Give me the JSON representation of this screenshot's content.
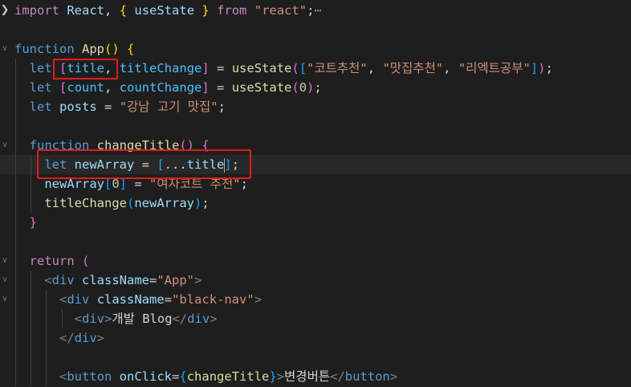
{
  "editor": {
    "lines": [
      {
        "tokens": [
          [
            "ctl",
            "import"
          ],
          [
            "pun",
            " "
          ],
          [
            "vr",
            "React"
          ],
          [
            "pun",
            ", "
          ],
          [
            "br1",
            "{"
          ],
          [
            "pun",
            " "
          ],
          [
            "vr",
            "useState"
          ],
          [
            "pun",
            " "
          ],
          [
            "br1",
            "}"
          ],
          [
            "pun",
            " "
          ],
          [
            "ctl",
            "from"
          ],
          [
            "pun",
            " "
          ],
          [
            "str",
            "\"react\""
          ],
          [
            "pun",
            ";"
          ],
          [
            "ell",
            "⋯"
          ]
        ]
      },
      {
        "tokens": []
      },
      {
        "tokens": [
          [
            "kw",
            "function"
          ],
          [
            "pun",
            " "
          ],
          [
            "fn",
            "App"
          ],
          [
            "br1",
            "()"
          ],
          [
            "pun",
            " "
          ],
          [
            "br1",
            "{"
          ]
        ]
      },
      {
        "tokens": [
          [
            "pun",
            "  "
          ],
          [
            "kw",
            "let"
          ],
          [
            "pun",
            " "
          ],
          [
            "br2",
            "["
          ],
          [
            "cn",
            "title"
          ],
          [
            "pun",
            ", "
          ],
          [
            "cn",
            "titleChange"
          ],
          [
            "br2",
            "]"
          ],
          [
            "pun",
            " = "
          ],
          [
            "fn",
            "useState"
          ],
          [
            "br2",
            "("
          ],
          [
            "br3",
            "["
          ],
          [
            "str",
            "\"코트추천\""
          ],
          [
            "pun",
            ", "
          ],
          [
            "str",
            "\"맛집추천\""
          ],
          [
            "pun",
            ", "
          ],
          [
            "str",
            "\"리엑트공부\""
          ],
          [
            "br3",
            "]"
          ],
          [
            "br2",
            ")"
          ],
          [
            "pun",
            ";"
          ]
        ]
      },
      {
        "tokens": [
          [
            "pun",
            "  "
          ],
          [
            "kw",
            "let"
          ],
          [
            "pun",
            " "
          ],
          [
            "br2",
            "["
          ],
          [
            "cn",
            "count"
          ],
          [
            "pun",
            ", "
          ],
          [
            "cn",
            "countChange"
          ],
          [
            "br2",
            "]"
          ],
          [
            "pun",
            " = "
          ],
          [
            "fn",
            "useState"
          ],
          [
            "br2",
            "("
          ],
          [
            "num",
            "0"
          ],
          [
            "br2",
            ")"
          ],
          [
            "pun",
            ";"
          ]
        ]
      },
      {
        "tokens": [
          [
            "pun",
            "  "
          ],
          [
            "kw",
            "let"
          ],
          [
            "pun",
            " "
          ],
          [
            "vr",
            "posts"
          ],
          [
            "pun",
            " = "
          ],
          [
            "str",
            "\"강남 고기 맛집\""
          ],
          [
            "pun",
            ";"
          ]
        ]
      },
      {
        "tokens": []
      },
      {
        "tokens": [
          [
            "pun",
            "  "
          ],
          [
            "kw",
            "function"
          ],
          [
            "pun",
            " "
          ],
          [
            "fn",
            "changeTitle"
          ],
          [
            "br2",
            "()"
          ],
          [
            "pun",
            " "
          ],
          [
            "br2",
            "{"
          ]
        ]
      },
      {
        "tokens": [
          [
            "pun",
            "    "
          ],
          [
            "kw",
            "let"
          ],
          [
            "pun",
            " "
          ],
          [
            "vr",
            "newArray"
          ],
          [
            "pun",
            " = "
          ],
          [
            "br3",
            "["
          ],
          [
            "pun",
            "..."
          ],
          [
            "vr",
            "title"
          ],
          [
            "caret",
            ""
          ],
          [
            "br3",
            "]"
          ],
          [
            "pun",
            ";"
          ]
        ]
      },
      {
        "tokens": [
          [
            "pun",
            "    "
          ],
          [
            "vr",
            "newArray"
          ],
          [
            "br3",
            "["
          ],
          [
            "num",
            "0"
          ],
          [
            "br3",
            "]"
          ],
          [
            "pun",
            " = "
          ],
          [
            "str",
            "\"여자코트 추천\""
          ],
          [
            "pun",
            ";"
          ]
        ]
      },
      {
        "tokens": [
          [
            "pun",
            "    "
          ],
          [
            "fn",
            "titleChange"
          ],
          [
            "br3",
            "("
          ],
          [
            "vr",
            "newArray"
          ],
          [
            "br3",
            ")"
          ],
          [
            "pun",
            ";"
          ]
        ]
      },
      {
        "tokens": [
          [
            "pun",
            "  "
          ],
          [
            "br2",
            "}"
          ]
        ]
      },
      {
        "tokens": []
      },
      {
        "tokens": [
          [
            "pun",
            "  "
          ],
          [
            "ctl",
            "return"
          ],
          [
            "pun",
            " "
          ],
          [
            "br2",
            "("
          ]
        ]
      },
      {
        "tokens": [
          [
            "pun",
            "    "
          ],
          [
            "angle",
            "<"
          ],
          [
            "tag",
            "div"
          ],
          [
            "pun",
            " "
          ],
          [
            "attr",
            "className"
          ],
          [
            "pun",
            "="
          ],
          [
            "str",
            "\"App\""
          ],
          [
            "angle",
            ">"
          ]
        ]
      },
      {
        "tokens": [
          [
            "pun",
            "      "
          ],
          [
            "angle",
            "<"
          ],
          [
            "tag",
            "div"
          ],
          [
            "pun",
            " "
          ],
          [
            "attr",
            "className"
          ],
          [
            "pun",
            "="
          ],
          [
            "str",
            "\"black-nav\""
          ],
          [
            "angle",
            ">"
          ]
        ]
      },
      {
        "tokens": [
          [
            "pun",
            "        "
          ],
          [
            "angle",
            "<"
          ],
          [
            "tag",
            "div"
          ],
          [
            "angle",
            ">"
          ],
          [
            "pun",
            "개발 Blog"
          ],
          [
            "angle",
            "</"
          ],
          [
            "tag",
            "div"
          ],
          [
            "angle",
            ">"
          ]
        ]
      },
      {
        "tokens": [
          [
            "pun",
            "      "
          ],
          [
            "angle",
            "</"
          ],
          [
            "tag",
            "div"
          ],
          [
            "angle",
            ">"
          ]
        ]
      },
      {
        "tokens": []
      },
      {
        "tokens": [
          [
            "pun",
            "      "
          ],
          [
            "angle",
            "<"
          ],
          [
            "tag",
            "button"
          ],
          [
            "pun",
            " "
          ],
          [
            "attr",
            "onClick"
          ],
          [
            "pun",
            "="
          ],
          [
            "br3",
            "{"
          ],
          [
            "fn",
            "changeTitle"
          ],
          [
            "br3",
            "}"
          ],
          [
            "angle",
            ">"
          ],
          [
            "pun",
            "변경버튼"
          ],
          [
            "angle",
            "</"
          ],
          [
            "tag",
            "button"
          ],
          [
            "angle",
            ">"
          ]
        ]
      }
    ]
  },
  "colors": {
    "background": "#1e1e1e",
    "highlight_box": "#e01b1b"
  },
  "icons": {
    "fold_collapsed": "chevron-right-icon",
    "fold_expanded": "chevron-down-icon"
  }
}
